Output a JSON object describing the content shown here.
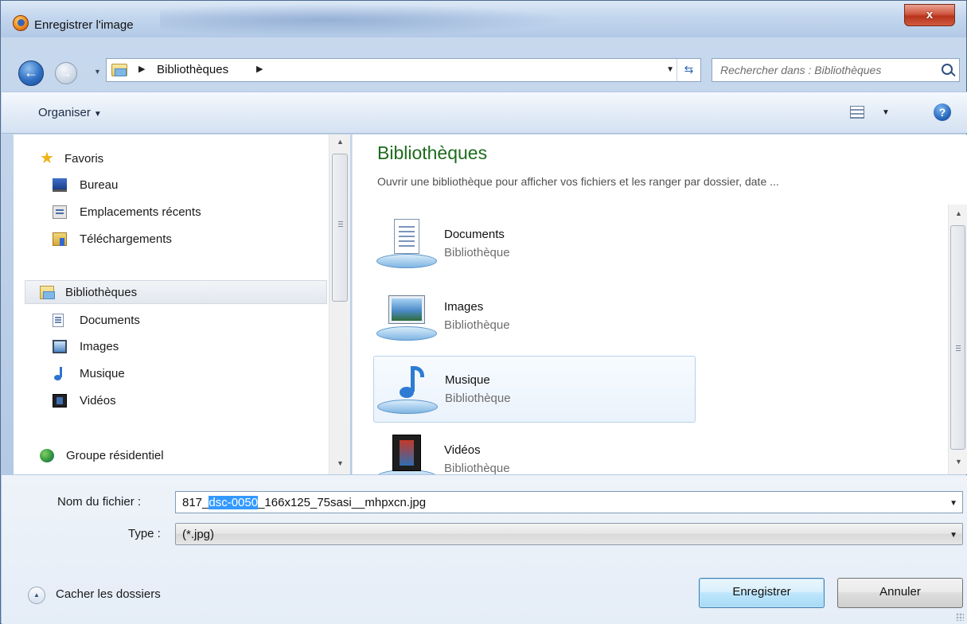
{
  "window": {
    "title": "Enregistrer l'image",
    "close_label": "x"
  },
  "nav": {
    "back_label": "←",
    "forward_label": "→",
    "breadcrumb": "Bibliothèques",
    "search_placeholder": "Rechercher dans : Bibliothèques"
  },
  "toolbar": {
    "organise_label": "Organiser",
    "help_label": "?"
  },
  "sidebar": {
    "items": [
      {
        "label": "Favoris"
      },
      {
        "label": "Bureau"
      },
      {
        "label": "Emplacements récents"
      },
      {
        "label": "Téléchargements"
      },
      {
        "label": "Bibliothèques"
      },
      {
        "label": "Documents"
      },
      {
        "label": "Images"
      },
      {
        "label": "Musique"
      },
      {
        "label": "Vidéos"
      },
      {
        "label": "Groupe résidentiel"
      }
    ]
  },
  "content": {
    "title": "Bibliothèques",
    "subtitle": "Ouvrir une bibliothèque pour afficher vos fichiers et les ranger par dossier, date ...",
    "libraries": [
      {
        "name": "Documents",
        "type": "Bibliothèque"
      },
      {
        "name": "Images",
        "type": "Bibliothèque"
      },
      {
        "name": "Musique",
        "type": "Bibliothèque"
      },
      {
        "name": "Vidéos",
        "type": "Bibliothèque"
      }
    ]
  },
  "form": {
    "filename_label": "Nom du fichier :",
    "filename_prefix": "817_",
    "filename_selected": "dsc-0050",
    "filename_suffix": "_166x125_75sasi__mhpxcn.jpg",
    "type_label": "Type :",
    "type_value": "(*.jpg)",
    "toggle_folders_label": "Cacher les dossiers",
    "save_label": "Enregistrer",
    "cancel_label": "Annuler"
  }
}
